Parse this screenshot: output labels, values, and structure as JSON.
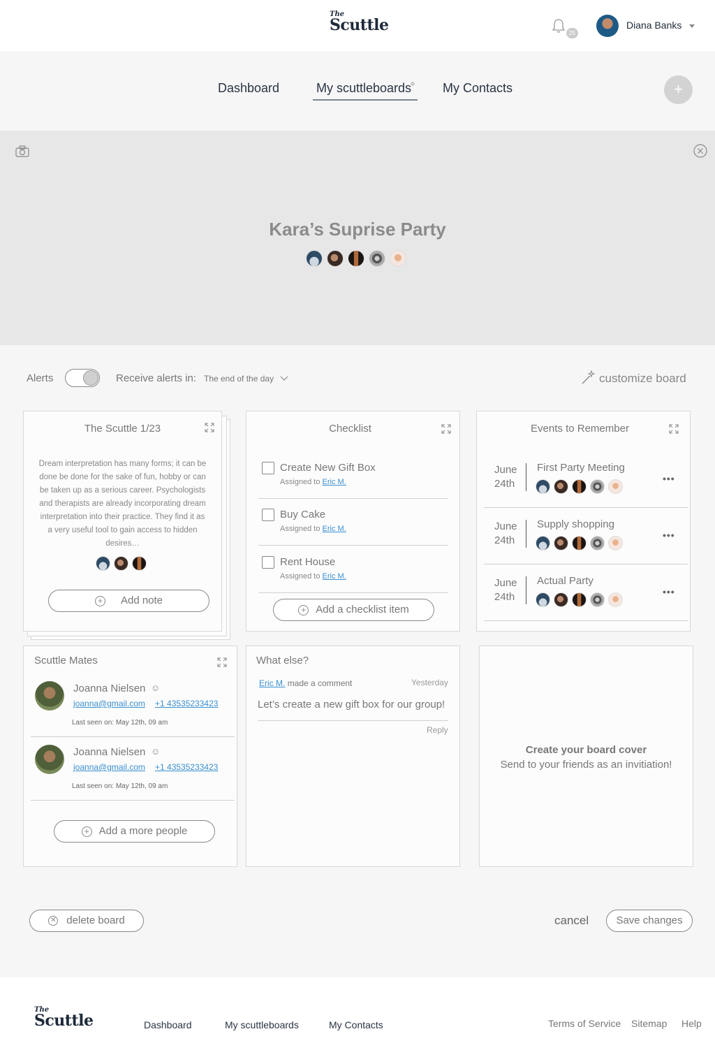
{
  "header": {
    "logo_the": "The",
    "logo_main": "Scuttle",
    "notification_count": "25",
    "user_name": "Diana Banks"
  },
  "nav": {
    "items": [
      "Dashboard",
      "My scuttleboards",
      "My Contacts"
    ],
    "fab_label": "+"
  },
  "cover": {
    "title": "Kara’s Suprise Party"
  },
  "alerts": {
    "label": "Alerts",
    "receive_label": "Receive alerts in:",
    "selected_value": "The end of the day",
    "customize": "customize board"
  },
  "note_card": {
    "title": "The Scuttle 1/23",
    "body": "Dream interpretation has many forms; it can be done be done for the sake of fun, hobby or can be taken up as a serious career. Psychologists and therapists are already incorporating dream interpretation into their practice. They find it as a very useful tool to gain access to hidden desires…",
    "add_label": "Add note"
  },
  "checklist": {
    "title": "Checklist",
    "assigned_prefix": "Assigned to",
    "items": [
      {
        "label": "Create New Gift Box",
        "assignee": "Eric M."
      },
      {
        "label": "Buy Cake",
        "assignee": "Eric M."
      },
      {
        "label": "Rent House",
        "assignee": "Eric M."
      }
    ],
    "add_label": "Add a checklist item"
  },
  "events": {
    "title": "Events to Remember",
    "items": [
      {
        "month": "June",
        "day": "24th",
        "name": "First Party Meeting"
      },
      {
        "month": "June",
        "day": "24th",
        "name": "Supply shopping"
      },
      {
        "month": "June",
        "day": "24th",
        "name": "Actual Party"
      }
    ]
  },
  "mates": {
    "title": "Scuttle Mates",
    "people": [
      {
        "name": "Joanna Nielsen",
        "email": "joanna@gmail.com",
        "phone": "+1 43535233423",
        "seen": "Last seen on: May 12th, 09 am"
      },
      {
        "name": "Joanna Nielsen",
        "email": "joanna@gmail.com",
        "phone": "+1 43535233423",
        "seen": "Last seen on: May 12th, 09 am"
      }
    ],
    "add_label": "Add a  more people"
  },
  "comments": {
    "title": "What else?",
    "author": "Eric M.",
    "action": "made a comment",
    "time": "Yesterday",
    "text": "Let’s create a new gift box for our group!",
    "reply": "Reply"
  },
  "cover_card": {
    "title": "Create your board cover",
    "subtitle": "Send to your friends as an invitiation!"
  },
  "actions": {
    "delete": "delete board",
    "cancel": "cancel",
    "save": "Save changes"
  },
  "footer": {
    "logo_the": "The",
    "logo_main": "Scuttle",
    "nav": [
      "Dashboard",
      "My scuttleboards",
      "My Contacts"
    ],
    "links": [
      "Terms of Service",
      "Sitemap",
      "Help"
    ]
  }
}
